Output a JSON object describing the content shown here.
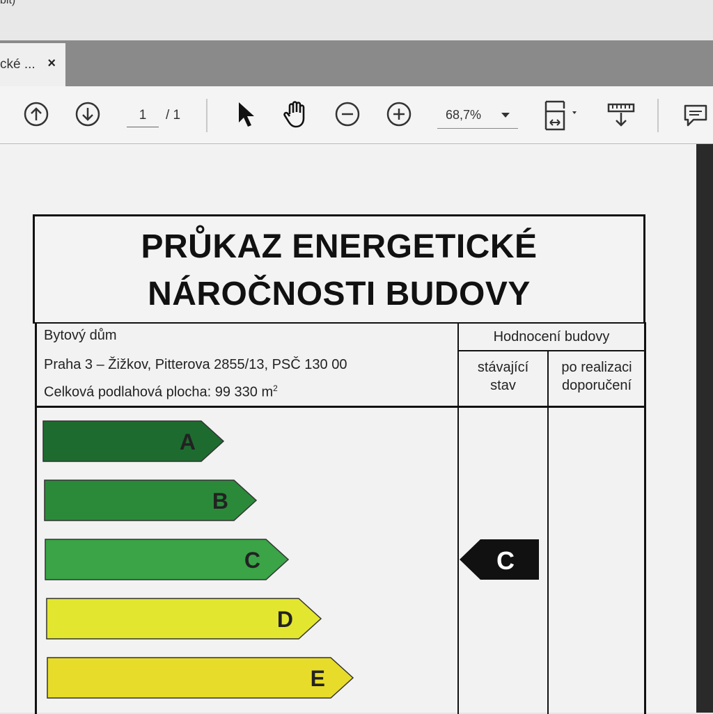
{
  "window": {
    "title_fragment": "bit)"
  },
  "tab": {
    "label": "cké ...",
    "close_glyph": "×"
  },
  "toolbar": {
    "page_current": "1",
    "page_total": "/ 1",
    "zoom": "68,7%"
  },
  "document": {
    "title_line1": "PRŮKAZ ENERGETICKÉ",
    "title_line2": "NÁROČNOSTI BUDOVY",
    "building_type": "Bytový dům",
    "address": "Praha 3 – Žižkov, Pitterova 2855/13, PSČ 130 00",
    "floor_area_label": "Celková podlahová plocha: 99 330 m",
    "floor_area_unit_sup": "2",
    "rating_header": "Hodnocení budovy",
    "col_current_line1": "stávající",
    "col_current_line2": "stav",
    "col_after_line1": "po realizaci",
    "col_after_line2": "doporučení",
    "current_class": "C",
    "classes": [
      {
        "letter": "A",
        "color": "#1e6b30"
      },
      {
        "letter": "B",
        "color": "#2b8a3a"
      },
      {
        "letter": "C",
        "color": "#3aa447"
      },
      {
        "letter": "D",
        "color": "#e3e62e"
      },
      {
        "letter": "E",
        "color": "#e8dc2a"
      }
    ]
  }
}
